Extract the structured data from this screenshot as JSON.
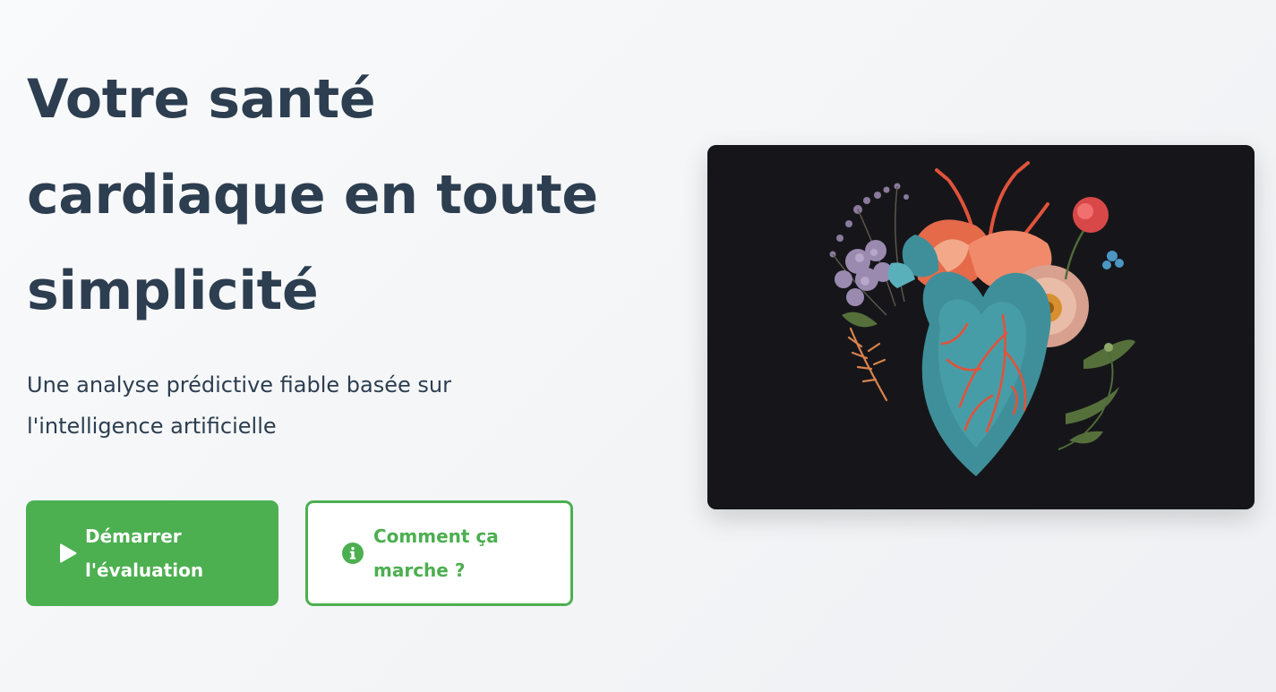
{
  "hero": {
    "title": "Votre santé cardiaque en toute simplicité",
    "subtitle": "Une analyse prédictive fiable basée sur l'intelligence artificielle"
  },
  "buttons": {
    "start": {
      "label": "Démarrer l'évaluation",
      "icon": "play-icon"
    },
    "how": {
      "label": "Comment ça marche ?",
      "icon": "info-circle-icon"
    }
  },
  "illustration": {
    "subject": "floral-anatomical-heart",
    "background_color": "#16161a"
  },
  "colors": {
    "primary": "#4caf50",
    "text": "#2c3e50"
  }
}
